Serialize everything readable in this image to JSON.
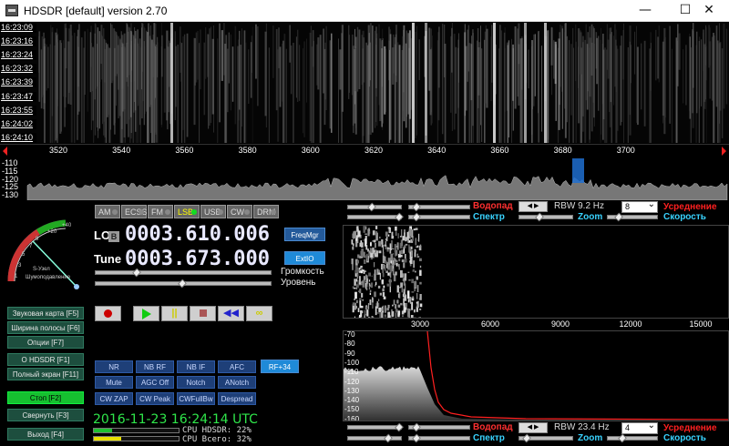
{
  "window": {
    "title": "HDSDR [default]  version 2.70",
    "min_icon": "minimize-icon",
    "max_icon": "maximize-icon",
    "close_icon": "close-icon"
  },
  "waterfall": {
    "time_labels": [
      "16:23:09",
      "16:23:16",
      "16:23:24",
      "16:23:32",
      "16:23:39",
      "16:23:47",
      "16:23:55",
      "16:24:02",
      "16:24:10"
    ]
  },
  "ruler": {
    "ticks": [
      "3520",
      "3540",
      "3560",
      "3580",
      "3600",
      "3620",
      "3640",
      "3660",
      "3680",
      "3700"
    ]
  },
  "spectrum_strip": {
    "db_labels": [
      "-110",
      "-115",
      "-120",
      "-125",
      "-130"
    ]
  },
  "modes": [
    {
      "label": "AM",
      "active": false
    },
    {
      "label": "ECSS",
      "active": false
    },
    {
      "label": "FM",
      "active": false
    },
    {
      "label": "LSB",
      "active": true
    },
    {
      "label": "USB",
      "active": false
    },
    {
      "label": "CW",
      "active": false
    },
    {
      "label": "DRM",
      "active": false
    }
  ],
  "tuning": {
    "lo_label": "LO",
    "lo_badge": "B",
    "lo_freq": "0003.610.006",
    "tune_label": "Tune",
    "tune_freq": "0003.673.000",
    "freqmgr": "FreqMgr",
    "extio": "ExtIO",
    "volume_label": "Громкость",
    "level_label": "Уровень",
    "volume_level": 0.22,
    "level_level": 0.49
  },
  "smeter": {
    "scale": [
      "1",
      "3",
      "5",
      "7",
      "9",
      "+20",
      "+40"
    ],
    "label1": "S-Узел",
    "label2": "Шумоподавление"
  },
  "side_buttons": [
    {
      "label": "Звуковая карта [F5]",
      "active": false
    },
    {
      "label": "Ширина полосы [F6]",
      "active": false
    },
    {
      "label": "Опции     [F7]",
      "active": false
    },
    {
      "label": "О   HDSDR    [F1]",
      "active": false
    },
    {
      "label": "Полный экран [F11]",
      "active": false
    },
    {
      "label": "Стоп      [F2]",
      "active": true
    },
    {
      "label": "Свернуть  [F3]",
      "active": false
    },
    {
      "label": "Выход     [F4]",
      "active": false
    }
  ],
  "transport": {
    "record_icon": "record-icon",
    "play_icon": "play-icon",
    "pause_icon": "pause-icon",
    "stop_icon": "stop-icon",
    "rewind_icon": "rewind-icon",
    "loop_icon": "loop-icon"
  },
  "dsp": {
    "row1": [
      "NR",
      "NB RF",
      "NB IF",
      "AFC"
    ],
    "row2": [
      "Mute",
      "AGC Off",
      "Notch",
      "ANotch"
    ],
    "row3": [
      "CW ZAP",
      "CW Peak",
      "CWFullBw",
      "Despread"
    ],
    "rf": "RF+34"
  },
  "status": {
    "datetime": "2016-11-23  16:24:14 UTC",
    "cpu_hdsdr": "CPU HDSDR: 22%",
    "cpu_total": "CPU Всего: 32%",
    "cpu_hdsdr_level": 0.22,
    "cpu_total_level": 0.32
  },
  "right_top": {
    "waterfall": "Водопад",
    "spectrum": "Спектр",
    "rbw": "RBW  9.2 Hz",
    "zoom": "Zoom",
    "avg_value": "8",
    "averaging": "Усреднение",
    "speed": "Скорость"
  },
  "right_bottom": {
    "waterfall": "Водопад",
    "spectrum": "Спектр",
    "rbw": "RBW 23.4 Hz",
    "zoom": "Zoom",
    "avg_value": "4",
    "averaging": "Усреднение",
    "speed": "Скорость"
  },
  "af_axis": [
    "3000",
    "6000",
    "9000",
    "12000",
    "15000"
  ],
  "af_db": [
    "-70",
    "-80",
    "-90",
    "-100",
    "-110",
    "-120",
    "-130",
    "-140",
    "-150",
    "-160"
  ],
  "colors": {
    "accent_cyan": "#39d3ff",
    "accent_red": "#ff2a2a",
    "stop_green": "#16c030",
    "clock_green": "#2fe64a"
  }
}
